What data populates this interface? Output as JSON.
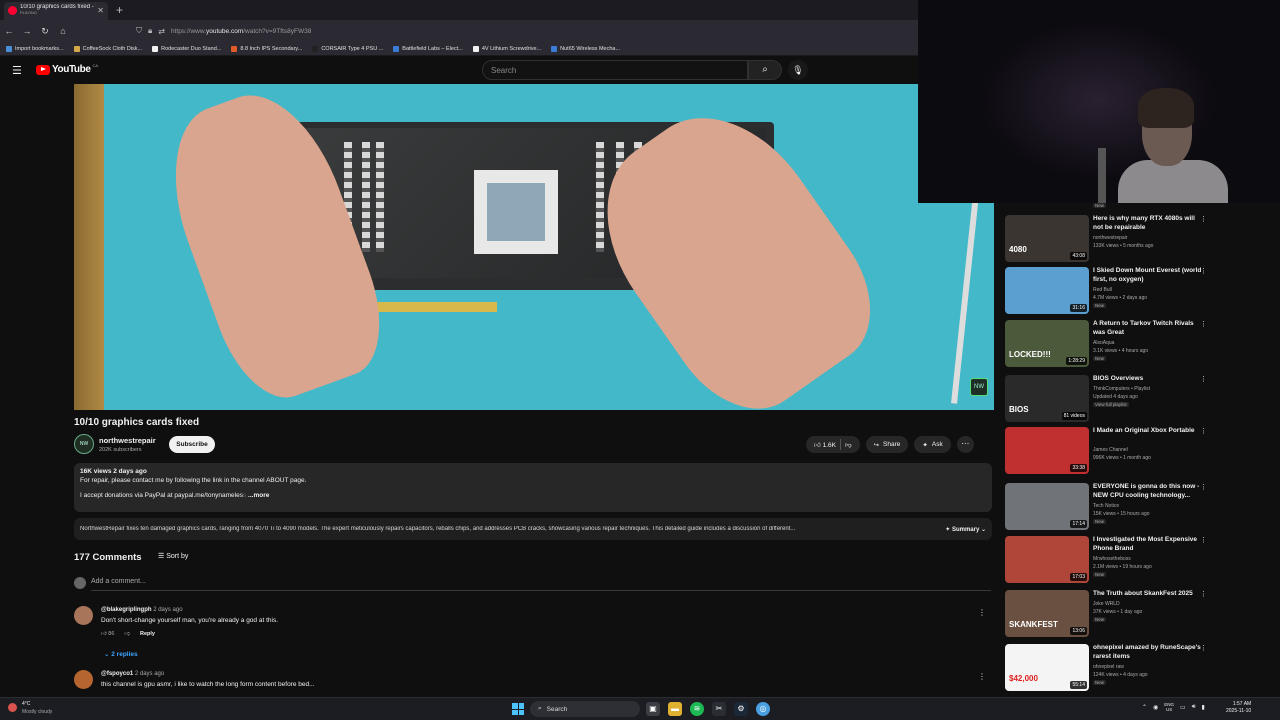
{
  "browser": {
    "tab_title": "10/10 graphics cards fixed - Yo",
    "tab_status": "PLAYING",
    "new_tab": "+",
    "url_prefix": "https://www.",
    "url_host": "youtube.com",
    "url_path": "/watch?v=9Tfts8yFW38",
    "bookmarks": [
      {
        "label": "Import bookmarks...",
        "color": "#4a90d9"
      },
      {
        "label": "CoffeeSock Cloth Disk...",
        "color": "#d4a84a"
      },
      {
        "label": "Rodecaster Duo Stand...",
        "color": "#f1f1f1"
      },
      {
        "label": "8.8 Inch IPS Secondary...",
        "color": "#e05a2a"
      },
      {
        "label": "CORSAIR Type 4 PSU ...",
        "color": "#222"
      },
      {
        "label": "Battlefield Labs – Elect...",
        "color": "#3a7bd5"
      },
      {
        "label": "4V Lithium Screwdrive...",
        "color": "#f1f1f1"
      },
      {
        "label": "Nut65 Wireless Mecha...",
        "color": "#3a7bd5"
      }
    ]
  },
  "youtube": {
    "logo": "YouTube",
    "region": "CA",
    "search_placeholder": "Search"
  },
  "video": {
    "title": "10/10 graphics cards fixed",
    "channel": "northwestrepair",
    "subscribers": "202K subscribers",
    "subscribe_label": "Subscribe",
    "likes": "1.6K",
    "share_label": "Share",
    "ask_label": "Ask",
    "views_date": "16K views  2 days ago",
    "desc_line1": "For repair, please contact me by following the link in the channel ABOUT page.",
    "desc_line2_prefix": "I accept donations via PayPal at ",
    "desc_link": "paypal.me/tonynameles",
    "desc_fade": "s",
    "desc_more": "...more",
    "summary_text": "NorthwestRepair fixes ten damaged graphics cards, ranging from 4070 Ti to 4090 models. The expert meticulously repairs capacitors, reballs chips, and addresses PCB cracks, showcasing various repair techniques. This detailed guide includes a discussion of different...",
    "summary_label": "Summary",
    "badge": "NW"
  },
  "comments": {
    "count": "177 Comments",
    "sort_label": "Sort by",
    "add_placeholder": "Add a comment...",
    "items": [
      {
        "user": "@blakegriplingph",
        "time": "2 days ago",
        "text": "Don't short-change yourself man, you're already a god at this.",
        "likes": "86",
        "reply": "Reply",
        "avatar": "#a8745a"
      },
      {
        "user": "@fspoyco1",
        "time": "2 days ago",
        "text": "this channel is gpu asmr, i like to watch the long form content before bed...",
        "avatar": "#b5652f"
      }
    ],
    "replies_label": "2 replies"
  },
  "recommendations": [
    {
      "title": "Here is why many RTX 4080s will not be repairable",
      "channel": "northwestrepair",
      "meta": "133K views • 5 months ago",
      "duration": "43:08",
      "thumb_text": "4080",
      "thumb_bg": "#3a3530",
      "new": ""
    },
    {
      "title": "I Skied Down Mount Everest (world first, no oxygen)",
      "channel": "Red Bull",
      "meta": "4.7M views • 2 days ago",
      "duration": "31:16",
      "thumb_text": "",
      "thumb_bg": "#5a9fd0",
      "new": "New"
    },
    {
      "title": "A Return to Tarkov Twitch Rivals was Great",
      "channel": "AlsoAqua",
      "meta": "3.1K views • 4 hours ago",
      "duration": "1:28:29",
      "thumb_text": "LOCKED!!!",
      "thumb_bg": "#4a5a3a",
      "new": "New"
    },
    {
      "title": "BIOS Overviews",
      "channel": "ThinkComputers • Playlist",
      "meta": "Updated 4 days ago",
      "duration": "81 videos",
      "thumb_text": "BIOS",
      "thumb_bg": "#2a2a2a",
      "new": "View full playlist"
    },
    {
      "title": "I Made an Original Xbox Portable",
      "channel": "James Channel",
      "meta": "996K views • 1 month ago",
      "duration": "33:38",
      "thumb_text": "",
      "thumb_bg": "#c03030",
      "new": ""
    },
    {
      "title": "EVERYONE is gonna do this now - NEW CPU cooling technology...",
      "channel": "Tech Notice",
      "meta": "15K views • 15 hours ago",
      "duration": "17:14",
      "thumb_text": "",
      "thumb_bg": "#707478",
      "new": "New"
    },
    {
      "title": "I Investigated the Most Expensive Phone Brand",
      "channel": "Mrwhosetheboss",
      "meta": "2.1M views • 19 hours ago",
      "duration": "17:03",
      "thumb_text": "",
      "thumb_bg": "#b0463a",
      "new": "New"
    },
    {
      "title": "The Truth about SkankFest 2025",
      "channel": "Joke WRLD",
      "meta": "37K views • 1 day ago",
      "duration": "13:06",
      "thumb_text": "SKANKFEST",
      "thumb_bg": "#6a5040",
      "new": "New"
    },
    {
      "title": "ohnepixel amazed by RuneScape's rarest items",
      "channel": "ohnepixel raw",
      "meta": "124K views • 4 days ago",
      "duration": "55:14",
      "thumb_text": "$42,000",
      "thumb_bg": "#f4f4f4",
      "new": "New"
    }
  ],
  "rec_partial_new": "New",
  "taskbar": {
    "temp": "4°C",
    "condition": "Mostly cloudy",
    "search_label": "Search",
    "lang_top": "ENG",
    "lang_bottom": "US",
    "time": "1:57 AM",
    "date": "2025-11-10"
  }
}
